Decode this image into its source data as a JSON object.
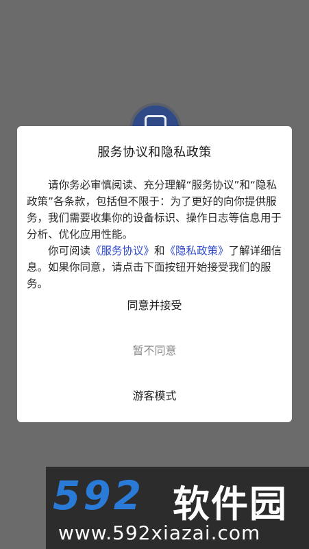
{
  "dialog": {
    "title": "服务协议和隐私政策",
    "paragraph1": "请你务必审慎阅读、充分理解“服务协议”和“隐私政策”各条款，包括但不限于：为了更好的向你提供服务，我们需要收集你的设备标识、操作日志等信息用于分析、优化应用性能。",
    "paragraph2_prefix": "你可阅读",
    "link_service": "《服务协议》",
    "and_text": "和",
    "link_privacy": "《隐私政策》",
    "paragraph2_suffix": "了解详细信息。如果你同意，请点击下面按钮开始接受我们的服务。",
    "accept_label": "同意并接受",
    "decline_label": "暂不同意",
    "guest_label": "游客模式"
  },
  "watermark": {
    "number": "592",
    "brand": "软件园",
    "url": "www.592xiazai.com"
  },
  "colors": {
    "overlay": "#6b6b6b",
    "link": "#2f4bd0",
    "watermark_number": "#2a7ad8"
  },
  "icons": {
    "app_logo": "app-logo-icon"
  }
}
